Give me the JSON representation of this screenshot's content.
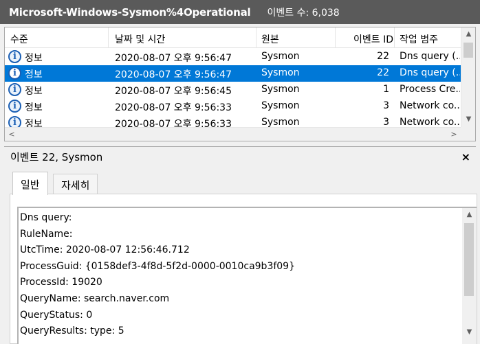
{
  "titlebar": {
    "log_name": "Microsoft-Windows-Sysmon%4Operational",
    "event_count": "이벤트 수: 6,038"
  },
  "columns": {
    "level": "수준",
    "datetime": "날짜 및 시간",
    "source": "원본",
    "event_id": "이벤트 ID",
    "task_category": "작업 범주"
  },
  "rows": [
    {
      "level": "정보",
      "datetime": "2020-08-07 오후 9:56:47",
      "source": "Sysmon",
      "event_id": "22",
      "task": "Dns query (..."
    },
    {
      "level": "정보",
      "datetime": "2020-08-07 오후 9:56:47",
      "source": "Sysmon",
      "event_id": "22",
      "task": "Dns query (..."
    },
    {
      "level": "정보",
      "datetime": "2020-08-07 오후 9:56:45",
      "source": "Sysmon",
      "event_id": "1",
      "task": "Process Cre..."
    },
    {
      "level": "정보",
      "datetime": "2020-08-07 오후 9:56:33",
      "source": "Sysmon",
      "event_id": "3",
      "task": "Network co..."
    },
    {
      "level": "정보",
      "datetime": "2020-08-07 오후 9:56:33",
      "source": "Sysmon",
      "event_id": "3",
      "task": "Network co..."
    }
  ],
  "selected_row_index": 1,
  "icons": {
    "info": "i",
    "scroll_up": "▲",
    "scroll_down": "▼",
    "scroll_left": "<",
    "scroll_right": ">",
    "close": "×"
  },
  "detail": {
    "header": "이벤트 22, Sysmon",
    "tabs": [
      "일반",
      "자세히"
    ],
    "active_tab": "일반",
    "lines": [
      "Dns query:",
      "RuleName:",
      "UtcTime: 2020-08-07 12:56:46.712",
      "ProcessGuid: {0158def3-4f8d-5f2d-0000-0010ca9b3f09}",
      "ProcessId: 19020",
      "QueryName: search.naver.com",
      "QueryStatus: 0",
      "QueryResults: type:  5"
    ]
  },
  "colors": {
    "titlebar_bg": "#5a5a5a",
    "selection": "#0078d7",
    "info_icon": "#1b5fb4"
  }
}
